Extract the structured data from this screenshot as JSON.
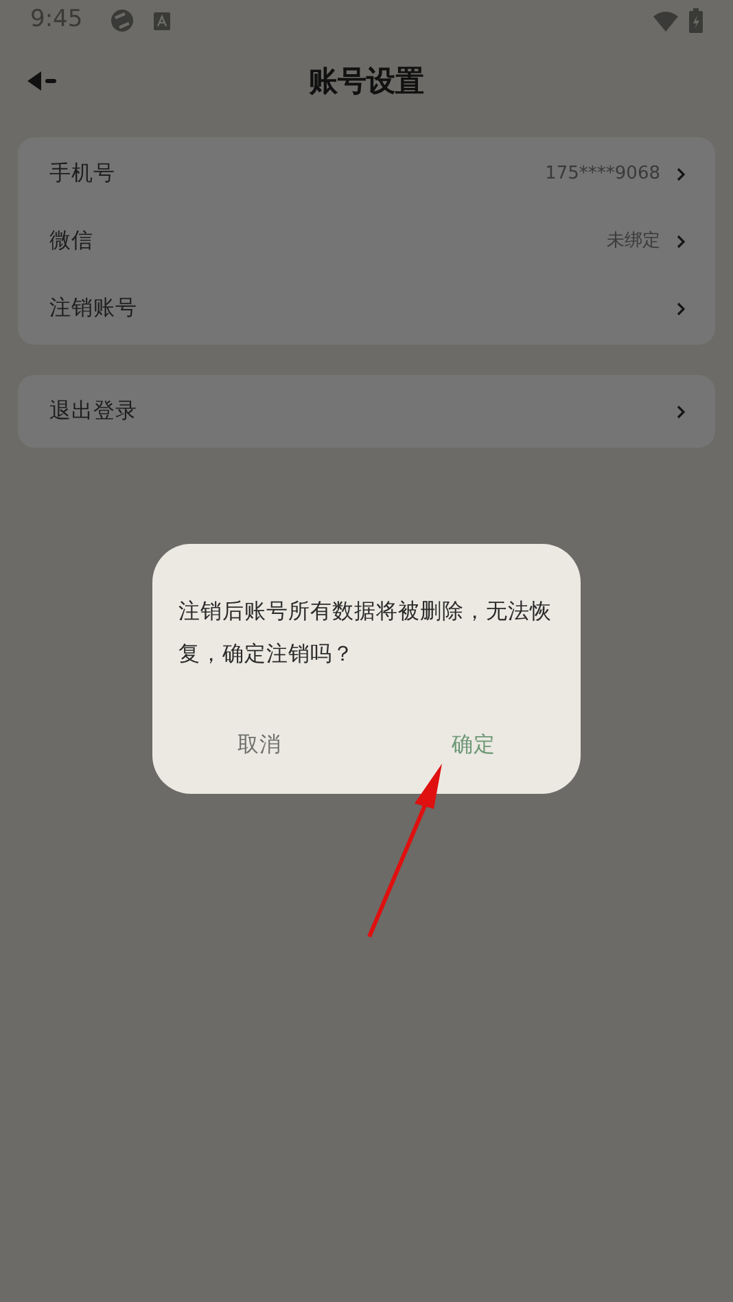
{
  "status_bar": {
    "time": "9:45"
  },
  "header": {
    "title": "账号设置"
  },
  "groups": [
    {
      "items": [
        {
          "label": "手机号",
          "value": "175****9068"
        },
        {
          "label": "微信",
          "value": "未绑定"
        },
        {
          "label": "注销账号"
        }
      ]
    },
    {
      "items": [
        {
          "label": "退出登录"
        }
      ]
    }
  ],
  "dialog": {
    "message": "注销后账号所有数据将被删除，无法恢复，确定注销吗？",
    "buttons": [
      {
        "label": "取消",
        "kind": "cancel"
      },
      {
        "label": "确定",
        "kind": "confirm"
      }
    ]
  }
}
